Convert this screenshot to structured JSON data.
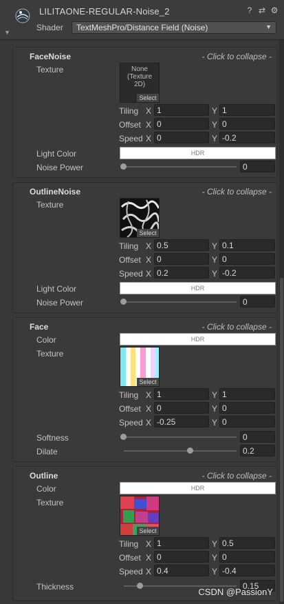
{
  "header": {
    "title": "LILITAONE-REGULAR-Noise_2",
    "shader_label": "Shader",
    "shader_value": "TextMeshPro/Distance Field (Noise)",
    "icons": [
      "help-icon",
      "preset-icon",
      "settings-icon"
    ]
  },
  "collapse_text": "- Click to collapse -",
  "texture_select": "Select",
  "hdr_text": "HDR",
  "axis": {
    "x": "X",
    "y": "Y"
  },
  "labels": {
    "texture": "Texture",
    "light_color": "Light Color",
    "noise_power": "Noise Power",
    "tiling": "Tiling",
    "offset": "Offset",
    "speed": "Speed",
    "color": "Color",
    "softness": "Softness",
    "dilate": "Dilate",
    "thickness": "Thickness"
  },
  "face_noise": {
    "title": "FaceNoise",
    "texture_none": "None\n(Texture\n2D)",
    "tiling": {
      "x": "1",
      "y": "1"
    },
    "offset": {
      "x": "0",
      "y": "0"
    },
    "speed": {
      "x": "0",
      "y": "-0.2"
    },
    "noise_power": "0"
  },
  "outline_noise": {
    "title": "OutlineNoise",
    "tiling": {
      "x": "0.5",
      "y": "0.1"
    },
    "offset": {
      "x": "0",
      "y": "0"
    },
    "speed": {
      "x": "0.2",
      "y": "-0.2"
    },
    "noise_power": "0"
  },
  "face": {
    "title": "Face",
    "tiling": {
      "x": "1",
      "y": "1"
    },
    "offset": {
      "x": "0",
      "y": "0"
    },
    "speed": {
      "x": "-0.25",
      "y": "0"
    },
    "softness": "0",
    "dilate": "0.2"
  },
  "outline": {
    "title": "Outline",
    "tiling": {
      "x": "1",
      "y": "0.5"
    },
    "offset": {
      "x": "0",
      "y": "0"
    },
    "speed": {
      "x": "0.4",
      "y": "-0.4"
    },
    "thickness": "0.15"
  },
  "watermark": "CSDN @PassionY",
  "colors": {
    "background": "#383838",
    "field": "#2a2a2a",
    "hdr_swatch": "#ffffff"
  }
}
